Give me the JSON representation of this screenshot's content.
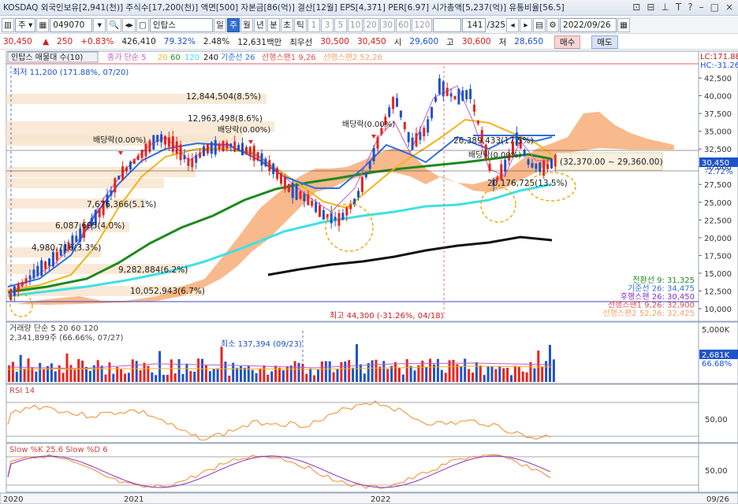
{
  "title_bar": {
    "text": "KOSDAQ 외국인보유[2,941(천)] 주식수[17,200(천)] 액면[500] 자본금[86(억)] 결산[12월] EPS[4,371] PER[6.97] 시가총액[5,237(억)] 유통비율[56.5]"
  },
  "toolbar": {
    "mode": "주",
    "code": "049070",
    "name": "인탑스",
    "periods": [
      "일",
      "주",
      "월",
      "년",
      "분",
      "초",
      "틱"
    ],
    "active_period": "주",
    "intervals": [
      "1",
      "3",
      "5",
      "10",
      "20",
      "30",
      "60",
      "120"
    ],
    "count": "141",
    "total": "/325",
    "date": "2022/09/26"
  },
  "quote": {
    "price": "30,450",
    "change": "250",
    "change_pct": "+0.83%",
    "volume": "426,410",
    "vol_ratio": "79.32%",
    "turnover": "2.48%",
    "amount": "12,631백만",
    "best_ask_label": "최우선",
    "best_ask": "30,500",
    "best_bid": "30,450",
    "open_label": "시",
    "open": "29,600",
    "high_label": "고",
    "high": "30,600",
    "low_label": "저",
    "low": "28,650",
    "buy_label": "매수",
    "sell_label": "매도"
  },
  "colors": {
    "up": "#e8231e",
    "down": "#1f53c9",
    "ma5": "#c45cc4",
    "ma20": "#f2b41a",
    "ma60": "#1e8a1e",
    "ma120": "#3fe0e6",
    "ma240": "#111111",
    "kijun": "#2f6fe0",
    "cloud": "#f5a265"
  },
  "main_panel": {
    "legend_name": "인탑스 매물대 수(10)",
    "legend_ma_title": "종가 단순 5",
    "legend_ma": [
      "20",
      "60",
      "120",
      "240"
    ],
    "legend_ichi": "기준선 26",
    "legend_span1": "선행스팬1 9,26",
    "legend_span2": "선행스팬2 52,26",
    "lc_label": "LC:171.88",
    "hc_label": "HC:-31.26",
    "y_ticks": [
      "42,500",
      "40,000",
      "37,500",
      "35,000",
      "32,500",
      "30,000",
      "27,500",
      "25,000",
      "22,500",
      "20,000",
      "17,500",
      "15,000",
      "12,500",
      "10,000"
    ],
    "current_price": "30,450",
    "current_pct": "-2.72%",
    "low_annotation": "최저 11,200 (171.88%, 07/20)",
    "high_annotation": "최고 44,300 (-31.26%, 04/18)",
    "range_label": "(32,370.00 ~ 29,360.00)",
    "dividend_labels": [
      "배당락(0.00%)",
      "배당락(0.00%)",
      "배당락(0.00%)",
      "배당락(0.00%)"
    ],
    "volume_profile": [
      "12,844,504(8.5%)",
      "12,963,498(8.6%)",
      "7,676,366(5.1%)",
      "6,087,695(4.0%)",
      "4,980,716(3.3%)",
      "9,282,884(6.2%)",
      "10,052,943(6.7%)",
      "26,389,433(17.5%)",
      "20,176,725(13.5%)"
    ],
    "ichimoku_values": [
      "전환선 9: 31,325",
      "기준선 26: 34,475",
      "후행스팬 26: 30,450",
      "선행스팬1 9,26: 32,900",
      "선행스팬2 52,26: 32,425"
    ]
  },
  "volume_panel": {
    "legend": "거래량 단순 5 20 60 120",
    "max_label": "2,341,899주 (66.66%, 07/27)",
    "min_label": "최소 137,394 (09/23)",
    "y_tick": "5,000K",
    "current": "2,681K",
    "current_pct": "66.68%"
  },
  "rsi_panel": {
    "legend": "RSI 14",
    "y_tick": "50,00"
  },
  "stoch_panel": {
    "legend": "Slow %K 25.6  Slow %D 6",
    "y_tick": "50,00"
  },
  "x_axis": {
    "labels": [
      "2020",
      "2021",
      "2022"
    ],
    "end_label": "09/26"
  }
}
